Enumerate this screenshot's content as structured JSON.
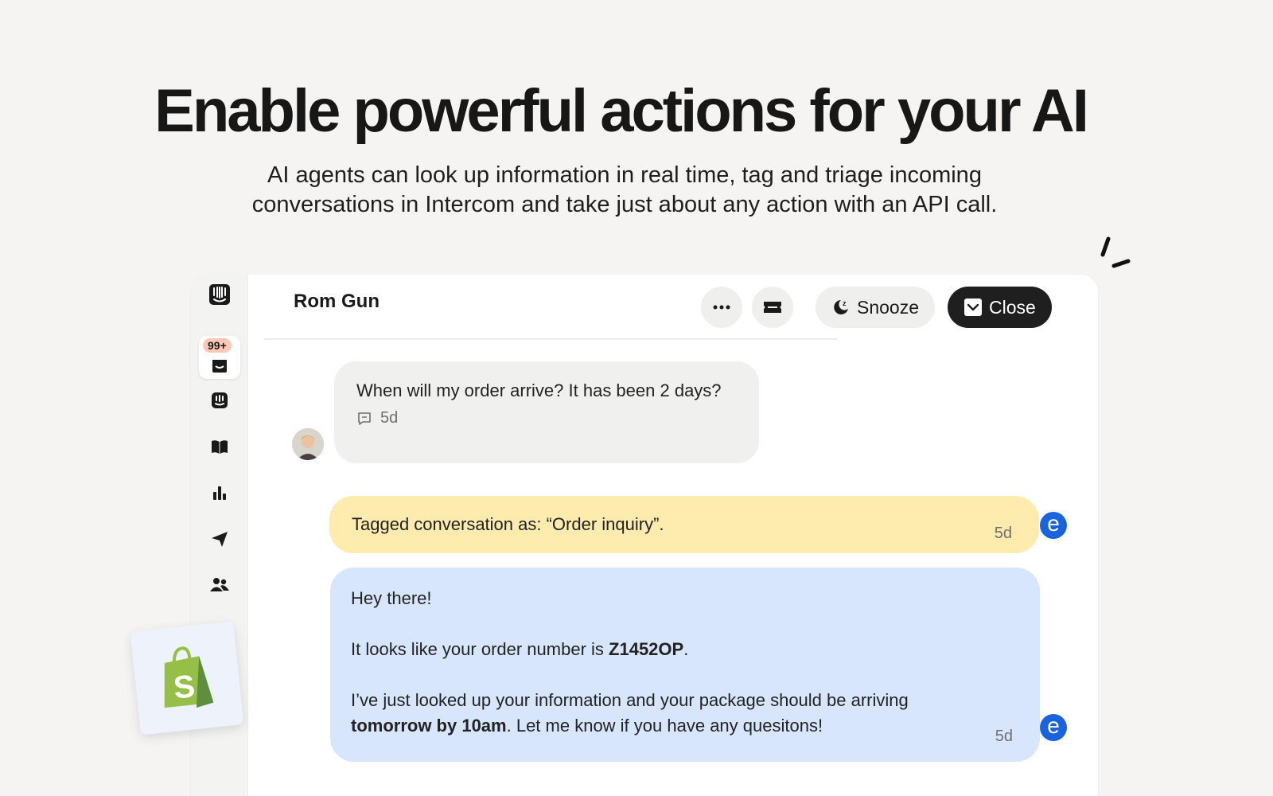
{
  "hero": {
    "headline": "Enable powerful actions for your AI",
    "subhead_line1": "AI agents can look up information in real time, tag and triage incoming",
    "subhead_line2": "conversations in Intercom and take just about any action with an API call."
  },
  "sidebar": {
    "inbox_badge": "99+",
    "items": [
      "intercom-logo",
      "inbox",
      "fin-ai",
      "knowledge",
      "reports",
      "outbound",
      "contacts"
    ]
  },
  "conversation": {
    "title": "Rom Gun",
    "actions": {
      "snooze_label": "Snooze",
      "close_label": "Close"
    },
    "messages": {
      "user": {
        "text": "When will my order arrive? It has been 2 days?",
        "time": "5d"
      },
      "tag_note": {
        "text": "Tagged conversation as: “Order inquiry”.",
        "time": "5d"
      },
      "bot": {
        "line1": "Hey there!",
        "line2_prefix": "It looks like your order number is ",
        "order_number": "Z1452OP",
        "line2_suffix": ".",
        "line3_prefix": "I’ve just looked up your information and your package should  be arriving",
        "line3_bold": "tomorrow by 10am",
        "line3_suffix": ". Let me know if you have any quesitons!",
        "time": "5d"
      },
      "agent_initial": "e"
    }
  },
  "colors": {
    "page_bg": "#f5f4f2",
    "tag_bg": "#feebae",
    "bot_bg": "#d7e6fc",
    "agent_blue": "#1963df",
    "close_btn": "#1f1f1f",
    "badge": "#ffc9b5",
    "shopify_green": "#95bf47"
  }
}
